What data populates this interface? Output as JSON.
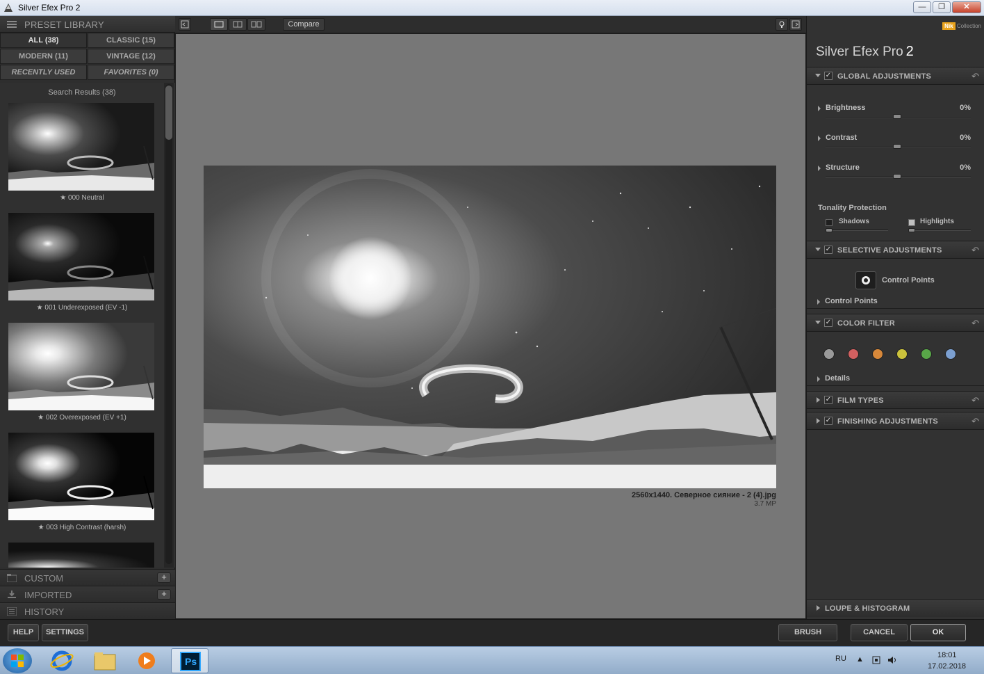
{
  "window": {
    "title": "Silver Efex Pro 2",
    "buttons": {
      "minimize": "—",
      "maximize": "❐",
      "close": "✕"
    }
  },
  "preset_library": {
    "header": "PRESET LIBRARY",
    "tabs": [
      {
        "label": "ALL (38)"
      },
      {
        "label": "CLASSIC (15)"
      },
      {
        "label": "MODERN (11)"
      },
      {
        "label": "VINTAGE (12)"
      },
      {
        "label": "RECENTLY USED"
      },
      {
        "label": "FAVORITES (0)"
      }
    ],
    "results_title": "Search Results (38)",
    "presets": [
      {
        "label": "★ 000 Neutral"
      },
      {
        "label": "★ 001 Underexposed (EV -1)"
      },
      {
        "label": "★ 002 Overexposed (EV +1)"
      },
      {
        "label": "★ 003 High Contrast (harsh)"
      }
    ],
    "sections": [
      {
        "label": "CUSTOM",
        "plus": "+"
      },
      {
        "label": "IMPORTED",
        "plus": "+"
      },
      {
        "label": "HISTORY"
      }
    ]
  },
  "toolbar": {
    "compare": "Compare"
  },
  "preview": {
    "caption": "2560x1440. Северное сияние - 2 (4).jpg",
    "megapixels": "3.7 MP"
  },
  "right_panel": {
    "logo_brand": "Nik",
    "logo_suffix": "Collection",
    "app_name": "Silver Efex Pro",
    "app_version": "2",
    "global": {
      "label": "GLOBAL ADJUSTMENTS",
      "sliders": [
        {
          "name": "Brightness",
          "value": "0%"
        },
        {
          "name": "Contrast",
          "value": "0%"
        },
        {
          "name": "Structure",
          "value": "0%"
        }
      ],
      "tonality_label": "Tonality Protection",
      "shadows": "Shadows",
      "highlights": "Highlights"
    },
    "selective": {
      "label": "SELECTIVE ADJUSTMENTS",
      "control_points_button": "Control Points",
      "control_points_row": "Control Points"
    },
    "color_filter": {
      "label": "COLOR FILTER",
      "colors": [
        "#9a9a9a",
        "#d26060",
        "#d7883a",
        "#cbc23c",
        "#58a648",
        "#7b9fd0"
      ],
      "details": "Details"
    },
    "film_types": "FILM TYPES",
    "finishing": "FINISHING ADJUSTMENTS",
    "loupe": "LOUPE & HISTOGRAM",
    "check": "✓",
    "undo": "↶"
  },
  "bottom": {
    "help": "HELP",
    "settings": "SETTINGS",
    "brush": "BRUSH",
    "cancel": "CANCEL",
    "ok": "OK"
  },
  "taskbar": {
    "lang": "RU",
    "time": "18:01",
    "date": "17.02.2018",
    "ps_label": "Ps"
  }
}
